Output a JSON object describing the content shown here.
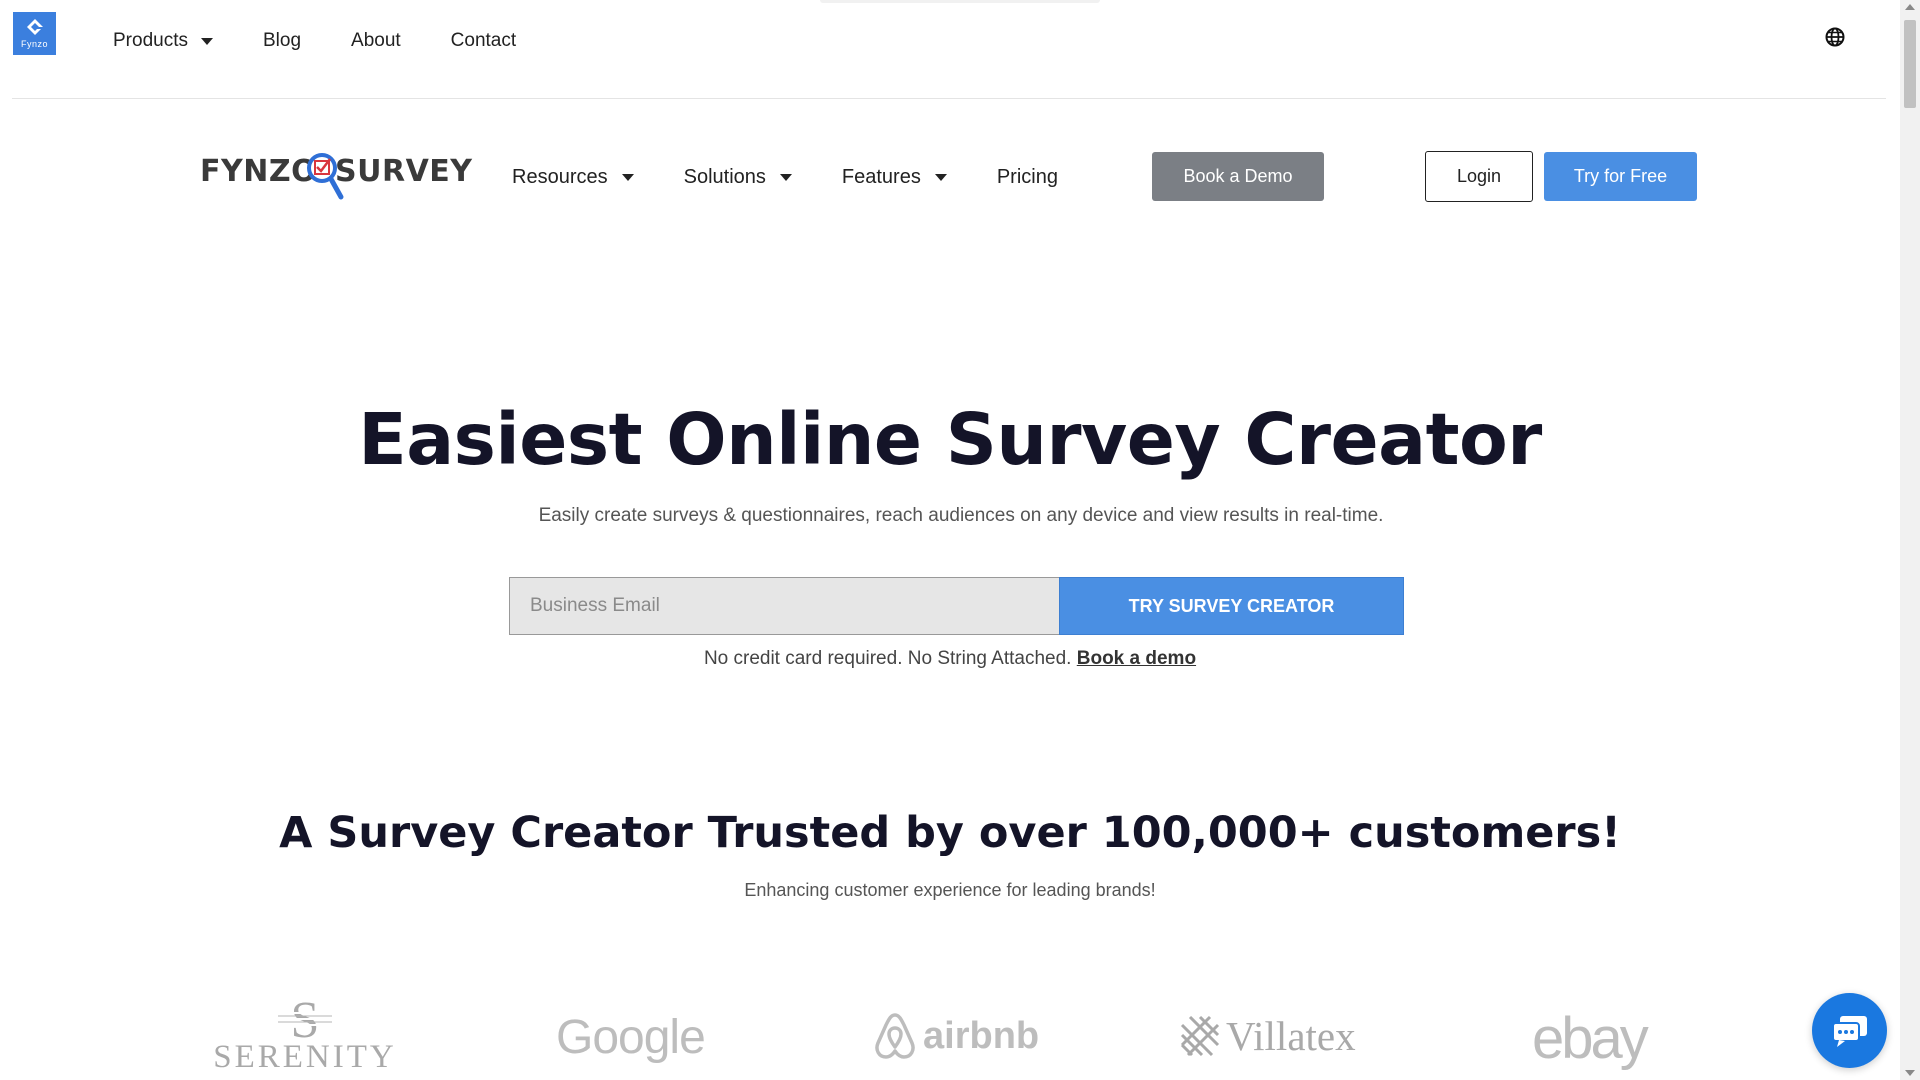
{
  "topbar": {
    "logo_text": "Fynzo",
    "nav": [
      {
        "label": "Products",
        "has_dropdown": true
      },
      {
        "label": "Blog",
        "has_dropdown": false
      },
      {
        "label": "About",
        "has_dropdown": false
      },
      {
        "label": "Contact",
        "has_dropdown": false
      }
    ],
    "language_icon": "globe-icon"
  },
  "header": {
    "brand_word_1": "FYNZO",
    "brand_word_2": "SURVEY",
    "nav": [
      {
        "label": "Resources",
        "has_dropdown": true
      },
      {
        "label": "Solutions",
        "has_dropdown": true
      },
      {
        "label": "Features",
        "has_dropdown": true
      },
      {
        "label": "Pricing",
        "has_dropdown": false
      }
    ],
    "book_demo_label": "Book a Demo",
    "login_label": "Login",
    "try_free_label": "Try for Free"
  },
  "hero": {
    "title": "Easiest Online Survey Creator",
    "subtitle": "Easily create surveys & questionnaires, reach audiences on any device and view results in real-time.",
    "email_placeholder": "Business Email",
    "email_value": "",
    "cta_label": "TRY SURVEY CREATOR",
    "note_text": "No credit card required. No String Attached.",
    "note_link": "Book a demo"
  },
  "trust": {
    "title": "A Survey Creator Trusted by over 100,000+ customers!",
    "subtitle": "Enhancing customer experience for leading brands!",
    "brands": [
      "SERENITY",
      "Google",
      "airbnb",
      "Villatex",
      "ebay"
    ]
  },
  "chat": {
    "icon": "chat-bubble-icon"
  },
  "colors": {
    "primary_blue": "#4a8fe3",
    "demo_gray": "#7b7f85",
    "logo_blue": "#3b7fde",
    "chat_blue": "#1a78e0",
    "heading": "#141428"
  }
}
